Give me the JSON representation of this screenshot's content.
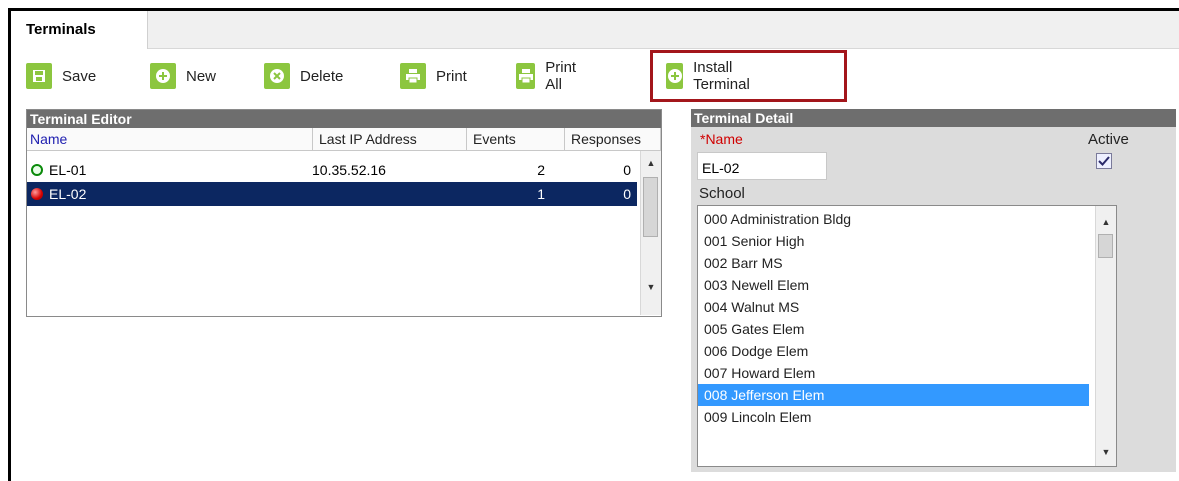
{
  "tabs": [
    {
      "label": "Terminals"
    }
  ],
  "toolbar": {
    "save": "Save",
    "new": "New",
    "delete": "Delete",
    "print": "Print",
    "print_all": "Print All",
    "install_terminal": "Install Terminal"
  },
  "editor": {
    "title": "Terminal Editor",
    "columns": {
      "name": "Name",
      "last_ip": "Last IP Address",
      "events": "Events",
      "responses": "Responses"
    },
    "rows": [
      {
        "name": "EL-01",
        "last_ip": "10.35.52.16",
        "events": "2",
        "responses": "0",
        "status": "online"
      },
      {
        "name": "EL-02",
        "last_ip": "",
        "events": "1",
        "responses": "0",
        "status": "offline"
      }
    ]
  },
  "detail": {
    "title": "Terminal Detail",
    "name_label": "*Name",
    "name_value": "EL-02",
    "active_label": "Active",
    "active_checked": true,
    "school_label": "School",
    "schools": [
      "000 Administration Bldg",
      "001 Senior High",
      "002 Barr MS",
      "003 Newell Elem",
      "004 Walnut MS",
      "005 Gates Elem",
      "006 Dodge Elem",
      "007 Howard Elem",
      "008 Jefferson Elem",
      "009 Lincoln Elem"
    ],
    "selected_school": "008 Jefferson Elem"
  },
  "colors": {
    "accent_green": "#8cc63f",
    "selection_dark": "#0c2761",
    "selection_blue": "#3399ff",
    "highlight_red": "#a3161b"
  }
}
